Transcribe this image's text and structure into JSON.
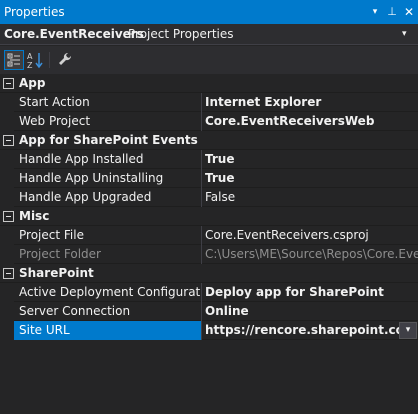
{
  "window": {
    "title": "Properties",
    "dropdown_glyph": "▾",
    "pin_glyph": "⊥",
    "close_glyph": "✕"
  },
  "object_selector": {
    "name": "Core.EventReceivers",
    "type": "Project Properties",
    "dropdown_glyph": "▾"
  },
  "toolbar": {
    "buttons": [
      {
        "name": "categorized-view",
        "icon": "categorized-icon",
        "active": true
      },
      {
        "name": "alphabetical-view",
        "icon": "sort-az-icon",
        "active": false
      },
      {
        "name": "property-pages",
        "icon": "wrench-icon",
        "active": false
      }
    ]
  },
  "categories": [
    {
      "label": "App",
      "properties": [
        {
          "name": "Start Action",
          "value": "Internet Explorer",
          "bold": true
        },
        {
          "name": "Web Project",
          "value": "Core.EventReceiversWeb",
          "bold": true
        }
      ]
    },
    {
      "label": "App for SharePoint Events",
      "properties": [
        {
          "name": "Handle App Installed",
          "value": "True",
          "bold": true
        },
        {
          "name": "Handle App Uninstalling",
          "value": "True",
          "bold": true
        },
        {
          "name": "Handle App Upgraded",
          "value": "False",
          "bold": false
        }
      ]
    },
    {
      "label": "Misc",
      "properties": [
        {
          "name": "Project File",
          "value": "Core.EventReceivers.csproj",
          "bold": false
        },
        {
          "name": "Project Folder",
          "value": "C:\\Users\\ME\\Source\\Repos\\Core.EventR",
          "bold": false,
          "disabled": true
        }
      ]
    },
    {
      "label": "SharePoint",
      "properties": [
        {
          "name": "Active Deployment Configuration",
          "value": "Deploy app for SharePoint",
          "bold": true
        },
        {
          "name": "Server Connection",
          "value": "Online",
          "bold": true
        },
        {
          "name": "Site URL",
          "value": "https://rencore.sharepoint.com/site",
          "bold": true,
          "selected": true,
          "dropdown_glyph": "▾"
        }
      ]
    }
  ],
  "colors": {
    "accent": "#007acc",
    "background": "#252526",
    "text": "#f1f1f1",
    "disabled_text": "#8e8e8e"
  }
}
